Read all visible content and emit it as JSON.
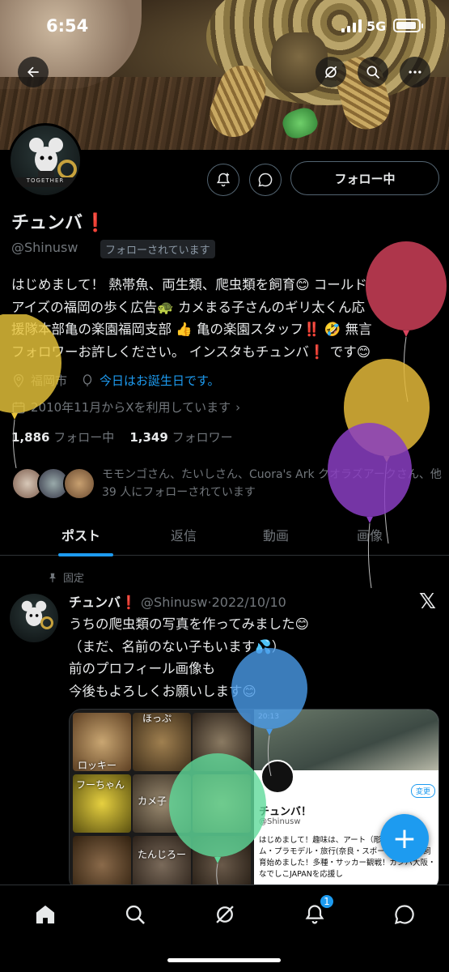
{
  "status_bar": {
    "time": "6:54",
    "network": "5G"
  },
  "profile": {
    "name": "チュンバ",
    "name_emoji": "❗",
    "handle": "@Shinusw",
    "follows_you_badge": "フォローされています",
    "follow_button": "フォロー中",
    "bio_lines": [
      "はじめまして！ 熱帯魚、両生類、爬虫類を飼育😊 コールド",
      "アイズの福岡の歩く広告🐢 カメまる子さんのギリ太くん応",
      "援隊本部亀の楽園福岡支部 👍 亀の楽園スタッフ‼️ 🤣 無言",
      "フォロワーお許しください。 インスタもチュンバ❗ です😊"
    ],
    "location": "福岡市",
    "birthday_link": "今日はお誕生日です。",
    "joined": "2010年11月からXを利用しています",
    "following_count": "1,886",
    "following_label": "フォロー中",
    "followers_count": "1,349",
    "followers_label": "フォロワー",
    "followed_by_text": "モモンゴさん、たいしさん、Cuora's Ark クオラズアークさん、他 39 人にフォローされています"
  },
  "tabs": [
    {
      "label": "ポスト",
      "active": true
    },
    {
      "label": "返信",
      "active": false
    },
    {
      "label": "動画",
      "active": false
    },
    {
      "label": "画像",
      "active": false
    }
  ],
  "pinned_post": {
    "pinned_label": "固定",
    "author_name": "チュンバ",
    "author_emoji": "❗",
    "author_handle": "@Shinusw",
    "date": "2022/10/10",
    "text_lines": [
      "うちの爬虫類の写真を作ってみました😊",
      "（まだ、名前のない子もいます💦）",
      "前のプロフィール画像も",
      "今後もよろしくお願いします😊"
    ],
    "media": {
      "grid_labels": [
        "ロッキー",
        "ほっぷ",
        "フーちゃん",
        "カメ子",
        "たんじろー"
      ],
      "phone_time": "20:13",
      "phone_name": "チュンバ！",
      "phone_handle": "@Shinusw",
      "phone_edit": "変更",
      "phone_text": "はじめまして！趣味は、アート（彫刻・書・ゲーム・プラモデル・旅行(奈良・スポーツ・熱帯魚飼育始めました！多種・サッカー観戦！ガンバ大阪・なでしこJAPANを応援し"
    }
  },
  "fab_label": "+",
  "nav": {
    "notification_count": "1"
  },
  "colors": {
    "accent": "#1d9bf0",
    "background": "#000000",
    "muted": "#71767b"
  },
  "icons": [
    "back-arrow-icon",
    "grok-icon",
    "search-icon",
    "more-icon",
    "bell-plus-icon",
    "message-icon",
    "location-pin-icon",
    "balloon-icon",
    "calendar-icon",
    "pin-icon",
    "x-logo-icon",
    "home-icon",
    "compose-plus-icon"
  ]
}
